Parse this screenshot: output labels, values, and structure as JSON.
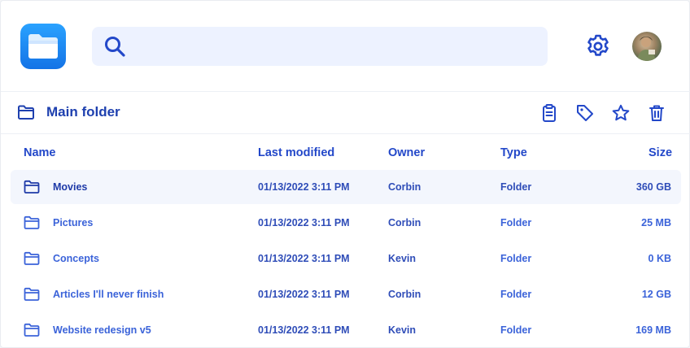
{
  "header": {
    "search": {
      "placeholder": "",
      "value": ""
    }
  },
  "folder": {
    "title": "Main folder",
    "actions": [
      "clipboard-icon",
      "tag-icon",
      "star-icon",
      "trash-icon"
    ]
  },
  "table": {
    "columns": {
      "name": "Name",
      "modified": "Last modified",
      "owner": "Owner",
      "type": "Type",
      "size": "Size"
    },
    "rows": [
      {
        "name": "Movies",
        "modified": "01/13/2022 3:11 PM",
        "owner": "Corbin",
        "type": "Folder",
        "size": "360 GB"
      },
      {
        "name": "Pictures",
        "modified": "01/13/2022 3:11 PM",
        "owner": "Corbin",
        "type": "Folder",
        "size": "25 MB"
      },
      {
        "name": "Concepts",
        "modified": "01/13/2022 3:11 PM",
        "owner": "Kevin",
        "type": "Folder",
        "size": "0 KB"
      },
      {
        "name": "Articles I'll never finish",
        "modified": "01/13/2022 3:11 PM",
        "owner": "Corbin",
        "type": "Folder",
        "size": "12 GB"
      },
      {
        "name": "Website redesign v5",
        "modified": "01/13/2022 3:11 PM",
        "owner": "Kevin",
        "type": "Folder",
        "size": "169 MB"
      }
    ]
  },
  "colors": {
    "accent": "#2348c9",
    "brand": "#1e88f0",
    "selected_row": "#f3f6fd",
    "search_bg": "#edf2ff"
  }
}
